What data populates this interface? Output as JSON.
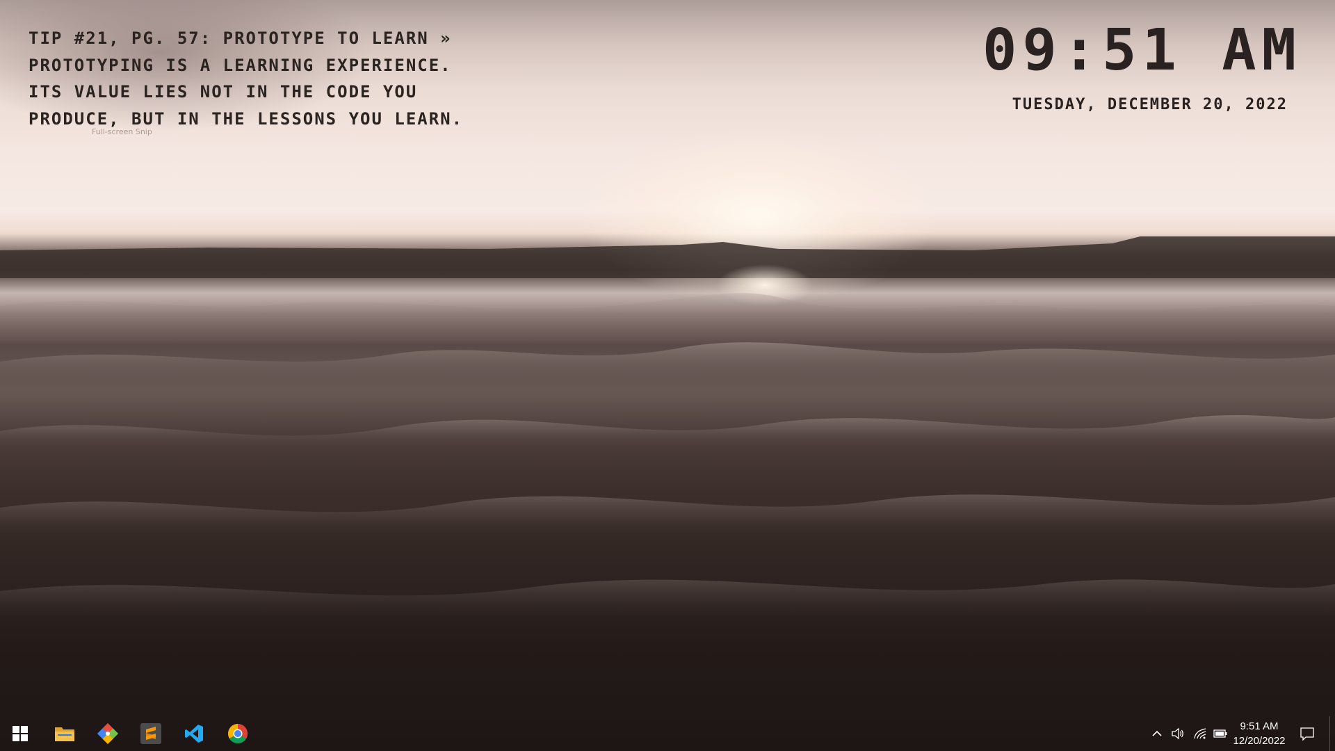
{
  "desktop": {
    "tip": {
      "text": "Tip #21, pg. 57: Prototype to Learn » Prototyping is a learning experience. Its value lies not in the code you produce, but in the lessons you learn."
    },
    "snip_label": "Full-screen Snip",
    "clock": {
      "time": "09:51 AM",
      "date": "Tuesday, December 20, 2022"
    }
  },
  "taskbar": {
    "start": {
      "icon": "windows-logo-icon"
    },
    "pinned_apps": [
      {
        "name": "File Explorer",
        "icon": "folder-icon"
      },
      {
        "name": "Git",
        "icon": "git-diamond-icon"
      },
      {
        "name": "Sublime Text",
        "icon": "sublime-text-icon"
      },
      {
        "name": "Visual Studio Code",
        "icon": "vscode-icon"
      },
      {
        "name": "Google Chrome",
        "icon": "chrome-icon"
      }
    ],
    "tray": {
      "icons": [
        "chevron-up-icon",
        "volume-icon",
        "network-icon",
        "battery-icon"
      ],
      "time": "9:51 AM",
      "date": "12/20/2022",
      "action_center_icon": "notification-icon"
    }
  },
  "colors": {
    "overlay_text": "#2a2220",
    "taskbar_text": "#ffffff",
    "explorer_yellow": "#f2c14e",
    "sublime_orange": "#ff9800",
    "vscode_blue": "#23a9f2",
    "chrome_red": "#db4437",
    "chrome_green": "#0f9d58",
    "chrome_yellow": "#f4b400",
    "chrome_blue": "#4285f4"
  }
}
